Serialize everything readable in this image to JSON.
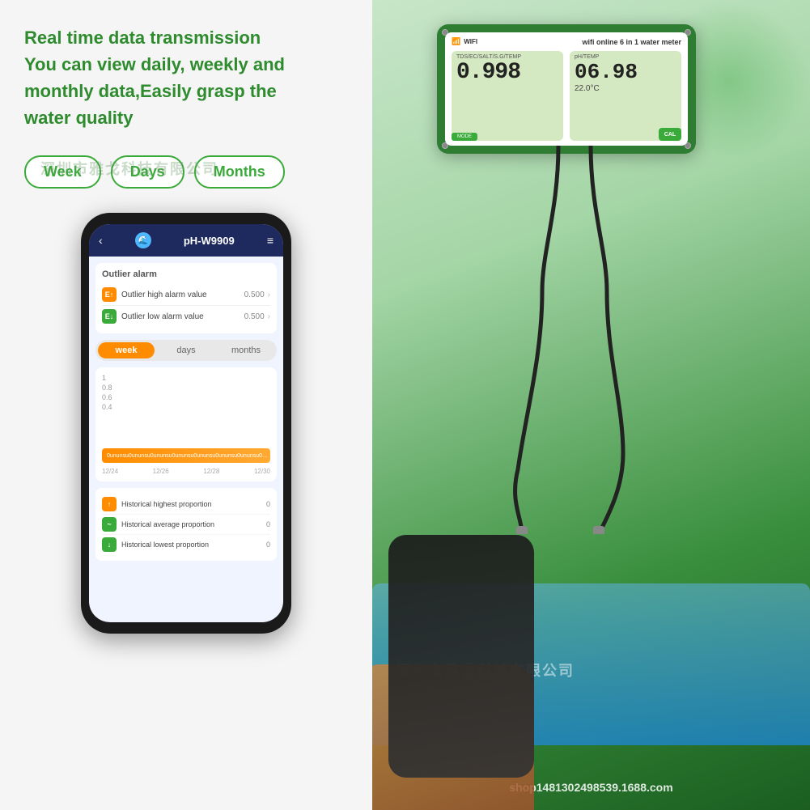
{
  "left": {
    "tagline": "Real time data transmission\nYou can view daily, weekly and\nmonthly data,Easily grasp the\nwater quality",
    "watermark": "深圳市雅戈科技有限公司",
    "tabs": [
      {
        "label": "Week"
      },
      {
        "label": "Days"
      },
      {
        "label": "Months"
      }
    ]
  },
  "phone": {
    "header": {
      "back_icon": "‹",
      "title": "pH-W9909",
      "menu_icon": "≡"
    },
    "alarm_section": {
      "title": "Outlier alarm",
      "rows": [
        {
          "label": "Outlier high alarm value",
          "value": "0.500",
          "icon_type": "orange"
        },
        {
          "label": "Outlier low alarm value",
          "value": "0.500",
          "icon_type": "green"
        }
      ]
    },
    "period_tabs": [
      {
        "label": "week",
        "active": true
      },
      {
        "label": "days",
        "active": false
      },
      {
        "label": "months",
        "active": false
      }
    ],
    "chart": {
      "y_labels": [
        "1",
        "0.8",
        "0.6",
        "0.4"
      ],
      "dates": [
        "12/24",
        "12/26",
        "12/28",
        "12/30"
      ],
      "bar_text": "0ununsu0ununsu0ununsu0ununsu0ununsu0ununsu0ununsu0ununsu0ununsu0"
    },
    "stats": [
      {
        "label": "Historical highest proportion",
        "value": "0",
        "icon_type": "orange"
      },
      {
        "label": "Historical average proportion",
        "value": "0",
        "icon_type": "green"
      },
      {
        "label": "Historical lowest proportion",
        "value": "0",
        "icon_type": "green"
      }
    ]
  },
  "device": {
    "wifi_label": "WIFI",
    "title": "wifi online 6 in 1 water meter",
    "left_labels": "TDS/EC/SALT/S.G/TEMP",
    "left_value": "0.998",
    "right_label": "pH/TEMP",
    "right_value": "06.98",
    "temp_value": "22.0°C",
    "mode_btn": "MODE",
    "cal_btn": "CAL"
  },
  "watermarks": {
    "right": "深圳市雅戈科技有限公司"
  },
  "footer": {
    "shop_url": "shop1481302498539.1688.com"
  },
  "colors": {
    "green_primary": "#2e8b2e",
    "green_dark": "#1b5e20",
    "orange": "#ff8c00",
    "bg_left": "#f5f5f5"
  }
}
